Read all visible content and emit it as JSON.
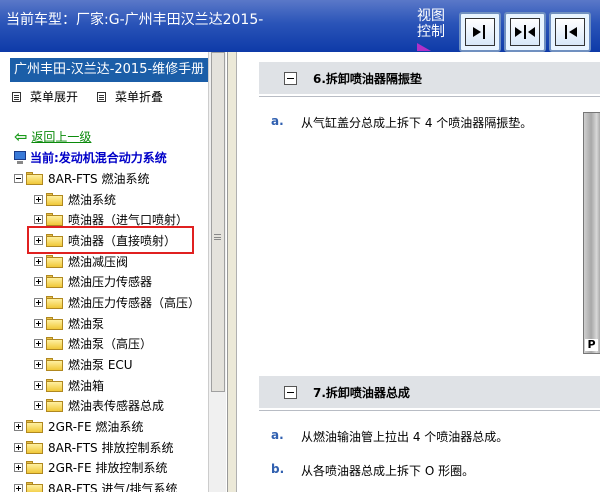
{
  "topbar": {
    "vehicle_text": "当前车型：厂家:G-广州丰田汉兰达2015-",
    "view_control": "视图控制"
  },
  "left": {
    "manual_title": "广州丰田-汉兰达-2015-维修手册",
    "expand_menu": "菜单展开",
    "collapse_menu": "菜单折叠",
    "back": "返回上一级",
    "current": "当前:发动机混合动力系统"
  },
  "tree": [
    {
      "label": "8AR-FTS 燃油系统",
      "expanded": true,
      "level": 0
    },
    {
      "label": "燃油系统",
      "level": 1
    },
    {
      "label": "喷油器（进气口喷射）",
      "level": 1
    },
    {
      "label": "喷油器（直接喷射）",
      "level": 1,
      "highlighted": true
    },
    {
      "label": "燃油减压阀",
      "level": 1
    },
    {
      "label": "燃油压力传感器",
      "level": 1
    },
    {
      "label": "燃油压力传感器（高压）",
      "level": 1
    },
    {
      "label": "燃油泵",
      "level": 1
    },
    {
      "label": "燃油泵（高压）",
      "level": 1
    },
    {
      "label": "燃油泵 ECU",
      "level": 1
    },
    {
      "label": "燃油箱",
      "level": 1
    },
    {
      "label": "燃油表传感器总成",
      "level": 1
    },
    {
      "label": "2GR-FE 燃油系统",
      "level": 0
    },
    {
      "label": "8AR-FTS 排放控制系统",
      "level": 0
    },
    {
      "label": "2GR-FE 排放控制系统",
      "level": 0
    },
    {
      "label": "8AR-FTS 进气/排气系统",
      "level": 0
    }
  ],
  "content": {
    "section6": {
      "title": "6.拆卸喷油器隔振垫",
      "steps": [
        {
          "letter": "a.",
          "text": "从气缸盖分总成上拆下 4 个喷油器隔振垫。"
        }
      ]
    },
    "section7": {
      "title": "7.拆卸喷油器总成",
      "steps": [
        {
          "letter": "a.",
          "text": "从燃油输油管上拉出 4 个喷油器总成。"
        },
        {
          "letter": "b.",
          "text": "从各喷油器总成上拆下 O 形圈。"
        }
      ]
    },
    "photo_label": "P"
  },
  "colors": {
    "topbar": "#1e4bb0",
    "manual_title_bg": "#1b5ea8",
    "back_link": "#0a8a0a",
    "current_text": "#0000c8",
    "highlight_box": "#e02020",
    "step_letter": "#3060b0",
    "section_header_bg": "#dfe2e6"
  }
}
